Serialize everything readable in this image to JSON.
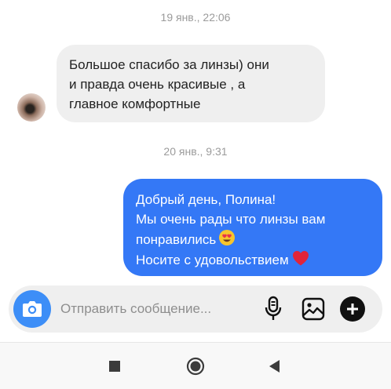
{
  "conversation": {
    "timestamps": [
      "19 янв., 22:06",
      "20 янв., 9:31"
    ],
    "incoming": {
      "lines": [
        "Большое спасибо за линзы) они",
        "и правда очень красивые , а",
        "главное комфортные"
      ]
    },
    "outgoing": {
      "lines": [
        "Добрый день, Полина!",
        "Мы очень рады что линзы вам",
        "понравились",
        "Носите с удовольствием"
      ],
      "emojis": [
        "😍",
        "❤️"
      ]
    }
  },
  "composer": {
    "placeholder": "Отправить сообщение...",
    "icons": [
      "camera-icon",
      "microphone-icon",
      "gallery-icon",
      "plus-icon"
    ]
  },
  "navigation": {
    "icons": [
      "recents-square-icon",
      "home-circle-icon",
      "back-triangle-icon"
    ]
  },
  "colors": {
    "outgoing_bubble": "#3478f6",
    "incoming_bubble": "#efefef",
    "camera_button": "#3d8ef7",
    "timestamp": "#9b9b9b"
  }
}
